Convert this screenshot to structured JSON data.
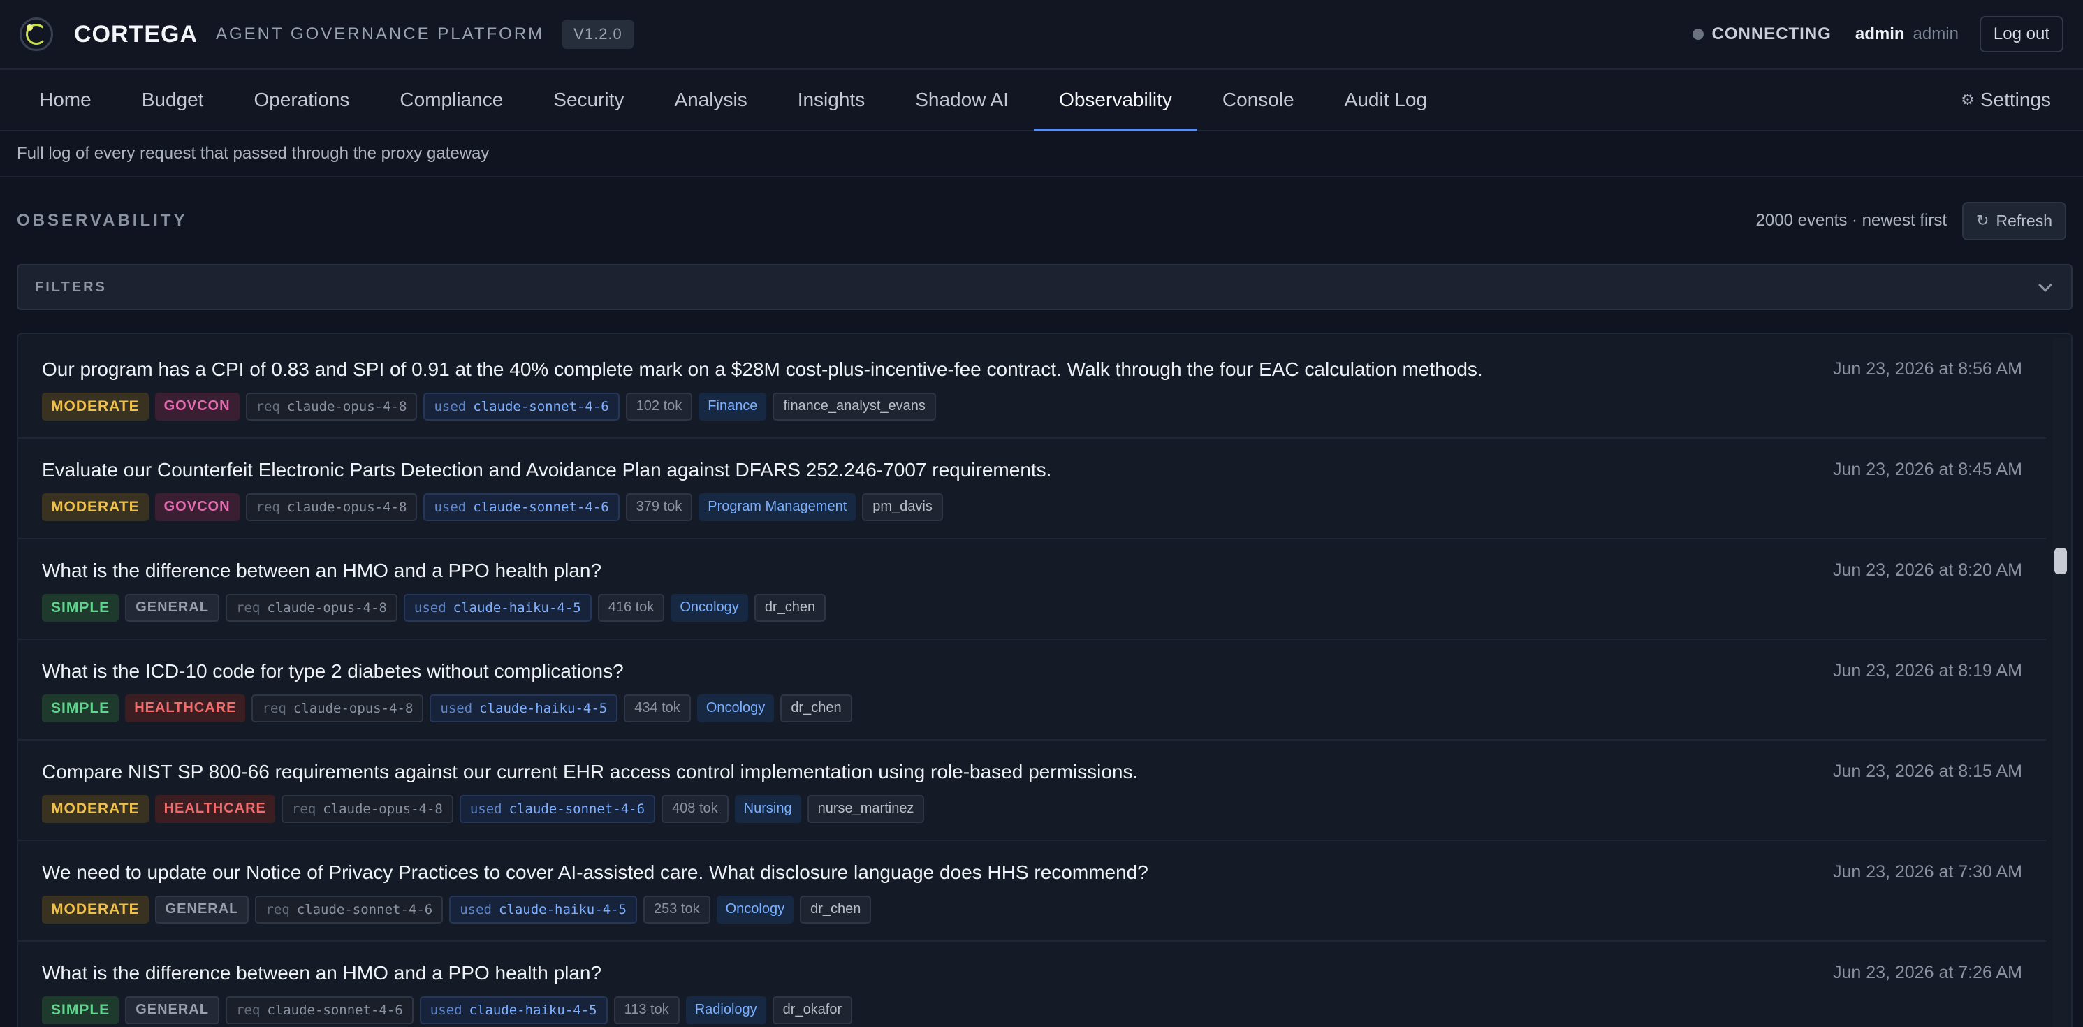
{
  "header": {
    "brand": "CORTEGA",
    "tagline": "AGENT GOVERNANCE PLATFORM",
    "version": "V1.2.0",
    "status": "CONNECTING",
    "user_name": "admin",
    "user_role": "admin",
    "logout_label": "Log out"
  },
  "nav": {
    "items": [
      "Home",
      "Budget",
      "Operations",
      "Compliance",
      "Security",
      "Analysis",
      "Insights",
      "Shadow AI",
      "Observability",
      "Console",
      "Audit Log"
    ],
    "active": "Observability",
    "settings_label": "Settings"
  },
  "page": {
    "subtitle": "Full log of every request that passed through the proxy gateway",
    "section_title": "OBSERVABILITY",
    "event_count": "2000 events · newest first",
    "refresh_label": "Refresh",
    "filters_label": "FILTERS"
  },
  "events": [
    {
      "title": "Our program has a CPI of 0.83 and SPI of 0.91 at the 40% complete mark on a $28M cost-plus-incentive-fee contract. Walk through the four EAC calculation methods.",
      "time": "Jun 23, 2026 at 8:56 AM",
      "complexity": "MODERATE",
      "domain": "GOVCON",
      "req_label": "req",
      "req_model": "claude-opus-4-8",
      "used_label": "used",
      "used_model": "claude-sonnet-4-6",
      "tokens": "102 tok",
      "dept": "Finance",
      "user": "finance_analyst_evans"
    },
    {
      "title": "Evaluate our Counterfeit Electronic Parts Detection and Avoidance Plan against DFARS 252.246-7007 requirements.",
      "time": "Jun 23, 2026 at 8:45 AM",
      "complexity": "MODERATE",
      "domain": "GOVCON",
      "req_label": "req",
      "req_model": "claude-opus-4-8",
      "used_label": "used",
      "used_model": "claude-sonnet-4-6",
      "tokens": "379 tok",
      "dept": "Program Management",
      "user": "pm_davis"
    },
    {
      "title": "What is the difference between an HMO and a PPO health plan?",
      "time": "Jun 23, 2026 at 8:20 AM",
      "complexity": "SIMPLE",
      "domain": "GENERAL",
      "req_label": "req",
      "req_model": "claude-opus-4-8",
      "used_label": "used",
      "used_model": "claude-haiku-4-5",
      "tokens": "416 tok",
      "dept": "Oncology",
      "user": "dr_chen"
    },
    {
      "title": "What is the ICD-10 code for type 2 diabetes without complications?",
      "time": "Jun 23, 2026 at 8:19 AM",
      "complexity": "SIMPLE",
      "domain": "HEALTHCARE",
      "req_label": "req",
      "req_model": "claude-opus-4-8",
      "used_label": "used",
      "used_model": "claude-haiku-4-5",
      "tokens": "434 tok",
      "dept": "Oncology",
      "user": "dr_chen"
    },
    {
      "title": "Compare NIST SP 800-66 requirements against our current EHR access control implementation using role-based permissions.",
      "time": "Jun 23, 2026 at 8:15 AM",
      "complexity": "MODERATE",
      "domain": "HEALTHCARE",
      "req_label": "req",
      "req_model": "claude-opus-4-8",
      "used_label": "used",
      "used_model": "claude-sonnet-4-6",
      "tokens": "408 tok",
      "dept": "Nursing",
      "user": "nurse_martinez"
    },
    {
      "title": "We need to update our Notice of Privacy Practices to cover AI-assisted care. What disclosure language does HHS recommend?",
      "time": "Jun 23, 2026 at 7:30 AM",
      "complexity": "MODERATE",
      "domain": "GENERAL",
      "req_label": "req",
      "req_model": "claude-sonnet-4-6",
      "used_label": "used",
      "used_model": "claude-haiku-4-5",
      "tokens": "253 tok",
      "dept": "Oncology",
      "user": "dr_chen"
    },
    {
      "title": "What is the difference between an HMO and a PPO health plan?",
      "time": "Jun 23, 2026 at 7:26 AM",
      "complexity": "SIMPLE",
      "domain": "GENERAL",
      "req_label": "req",
      "req_model": "claude-sonnet-4-6",
      "used_label": "used",
      "used_model": "claude-haiku-4-5",
      "tokens": "113 tok",
      "dept": "Radiology",
      "user": "dr_okafor"
    }
  ]
}
